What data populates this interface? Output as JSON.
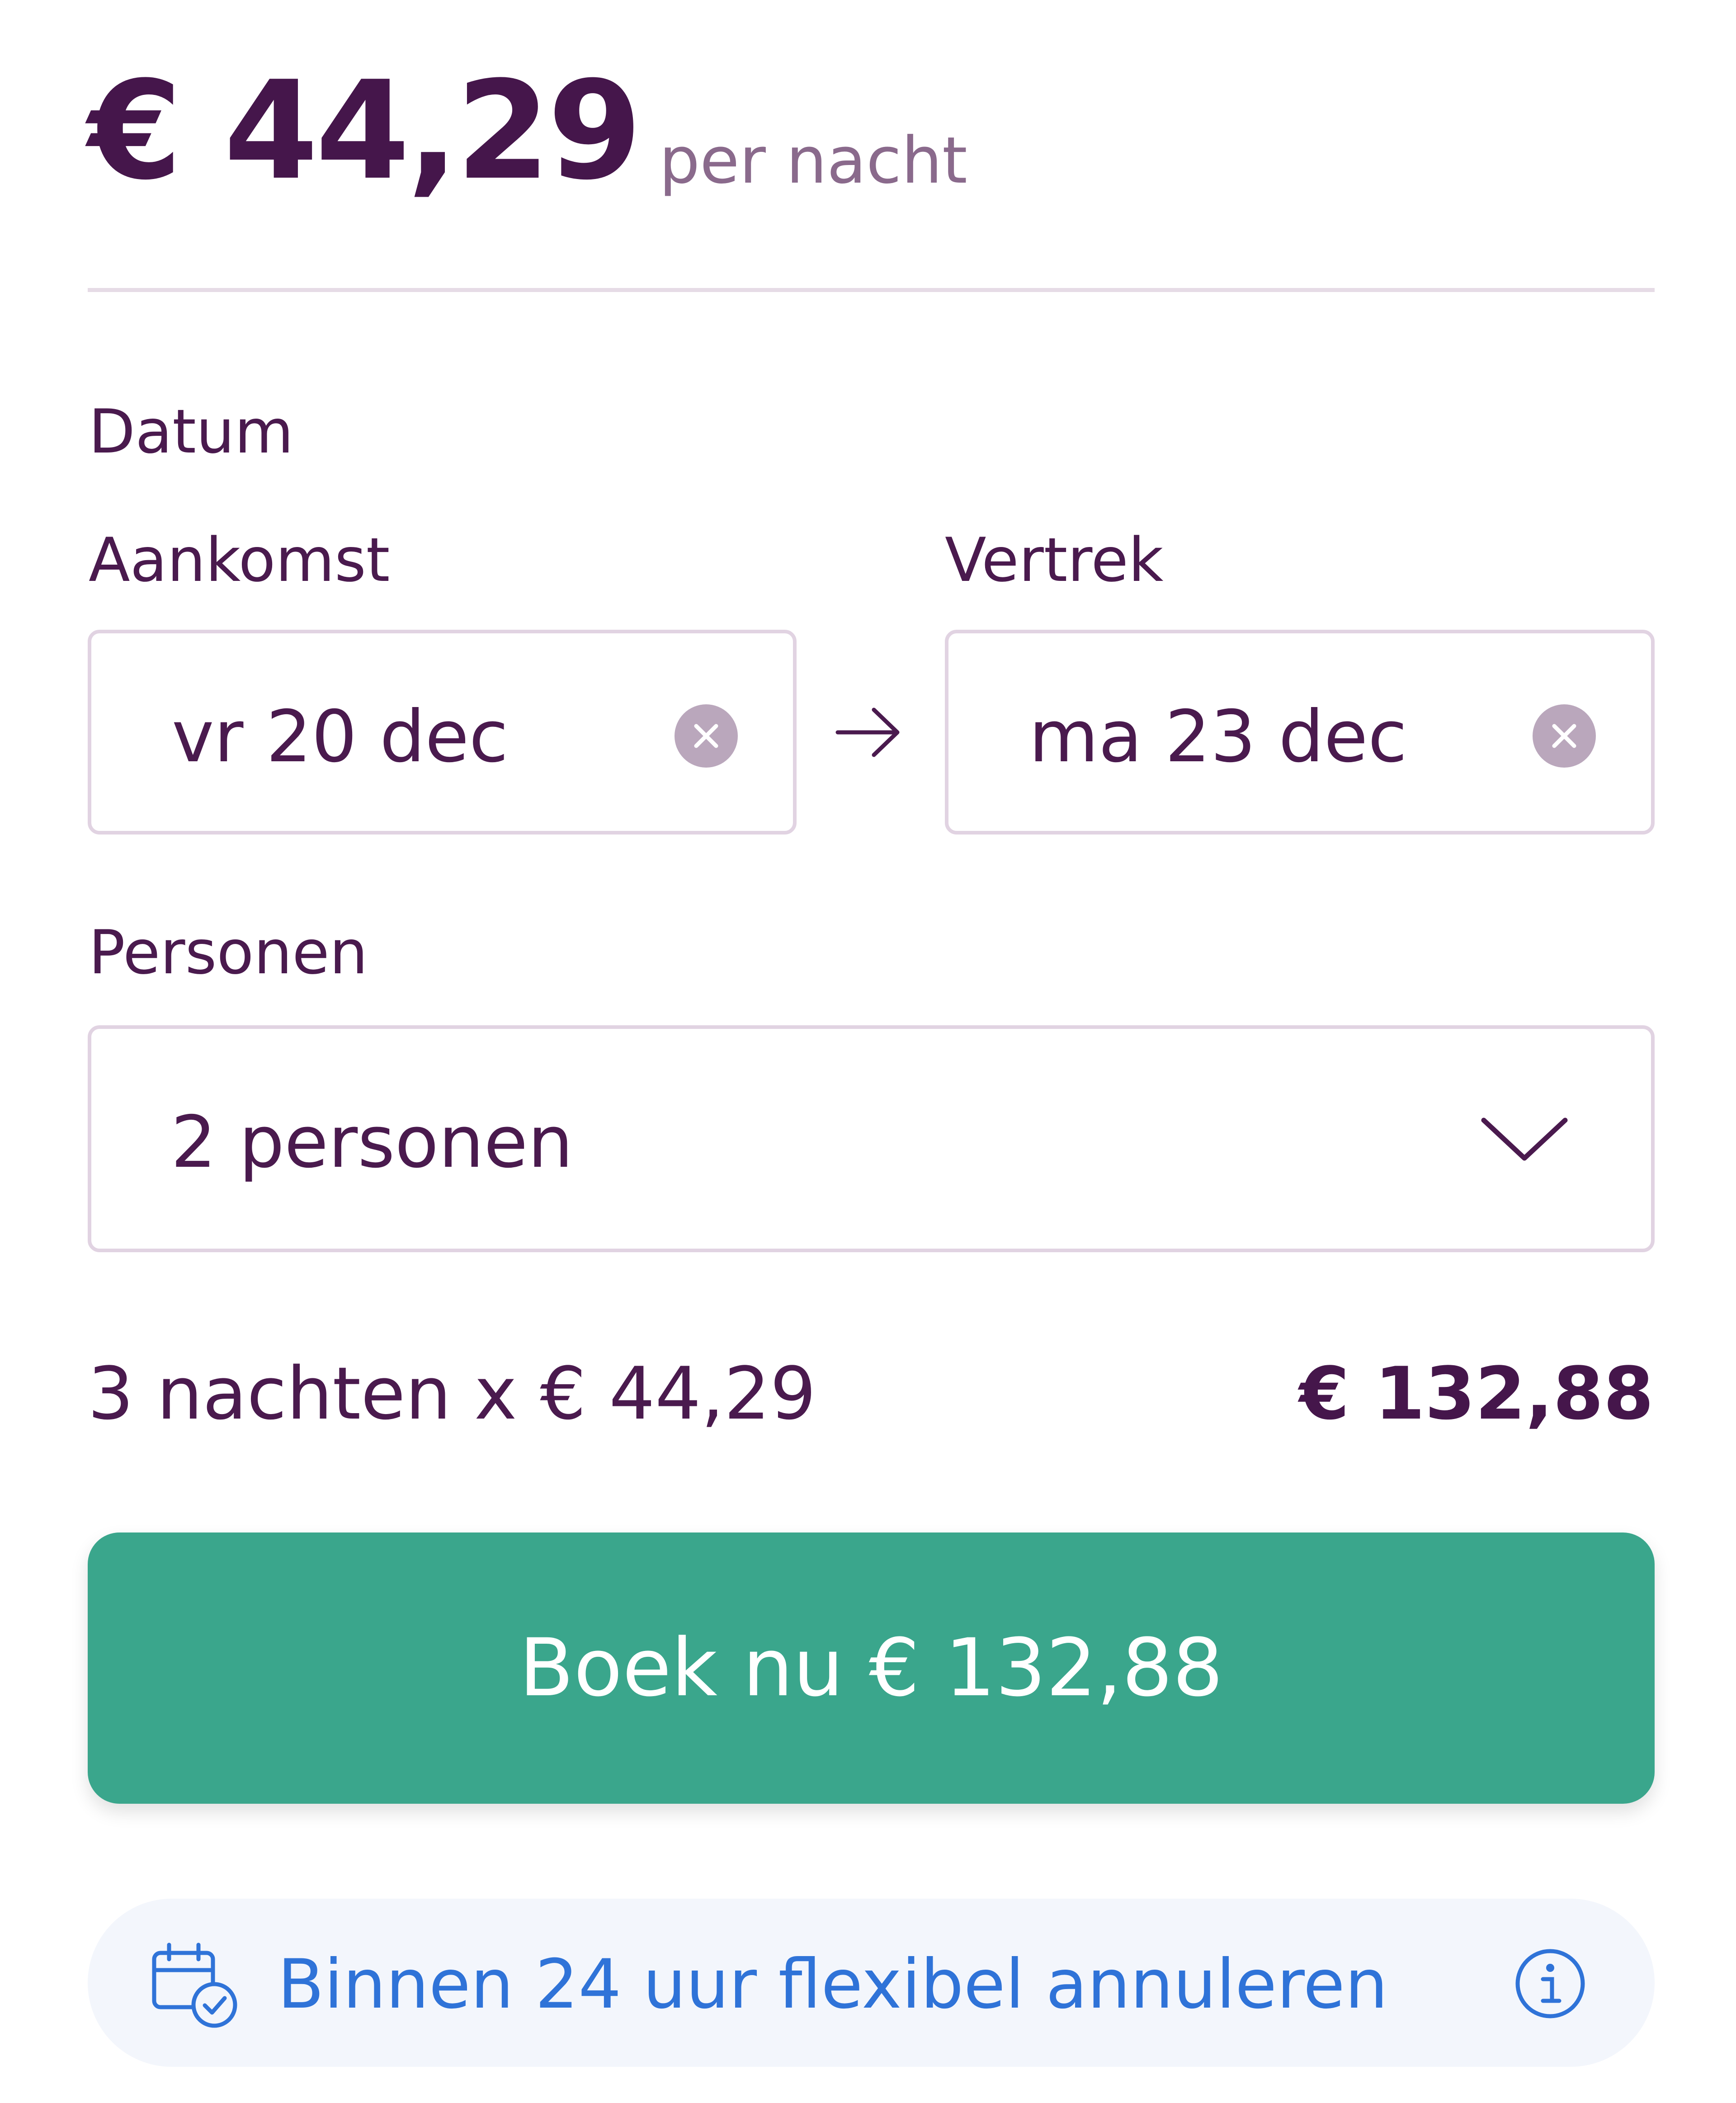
{
  "header": {
    "price": "€ 44,29",
    "price_unit": "per nacht"
  },
  "dates": {
    "section_label": "Datum",
    "arrival_label": "Aankomst",
    "arrival_value": "vr 20 dec",
    "departure_label": "Vertrek",
    "departure_value": "ma 23 dec"
  },
  "persons": {
    "label": "Personen",
    "selected": "2 personen"
  },
  "summary": {
    "calculation": "3 nachten x € 44,29",
    "total": "€ 132,88"
  },
  "cta": {
    "label": "Boek nu € 132,88"
  },
  "cancel_banner": {
    "text": "Binnen 24 uur flexibel annuleren"
  },
  "icons": {
    "clear": "close-icon",
    "arrow": "arrow-right-icon",
    "dropdown": "chevron-down-icon",
    "calendar": "calendar-check-icon",
    "info": "info-icon"
  },
  "colors": {
    "primary_text": "#45164b",
    "muted_text": "#8a6a8c",
    "border": "#e1d3e2",
    "cta_bg": "#3aa68c",
    "link_blue": "#2f73d8",
    "banner_bg": "#f3f6fc"
  }
}
